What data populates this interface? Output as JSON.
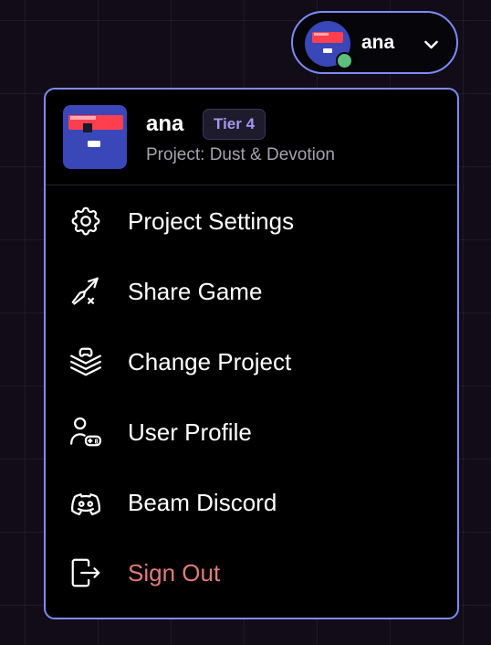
{
  "account": {
    "username": "ana",
    "online_status_color": "#5cc07a",
    "avatar_icon": "robot-avatar-icon",
    "toggle_icon": "chevron-down-icon"
  },
  "menu": {
    "header": {
      "name": "ana",
      "tier": "Tier 4",
      "project": "Project: Dust & Devotion"
    },
    "items": [
      {
        "label": "Project Settings",
        "icon": "gear-icon"
      },
      {
        "label": "Share Game",
        "icon": "rocket-launch-icon"
      },
      {
        "label": "Change Project",
        "icon": "layers-gamepad-icon"
      },
      {
        "label": "User Profile",
        "icon": "user-gamepad-icon"
      },
      {
        "label": "Beam Discord",
        "icon": "discord-icon"
      },
      {
        "label": "Sign Out",
        "icon": "sign-out-icon"
      }
    ]
  },
  "colors": {
    "accent_border": "#7e8cf6",
    "avatar_blue": "#3a47b8",
    "visor_red": "#ff3f4e",
    "tier_text": "#a596ee",
    "sign_out_text": "#e07b7b",
    "background": "#120c18"
  }
}
